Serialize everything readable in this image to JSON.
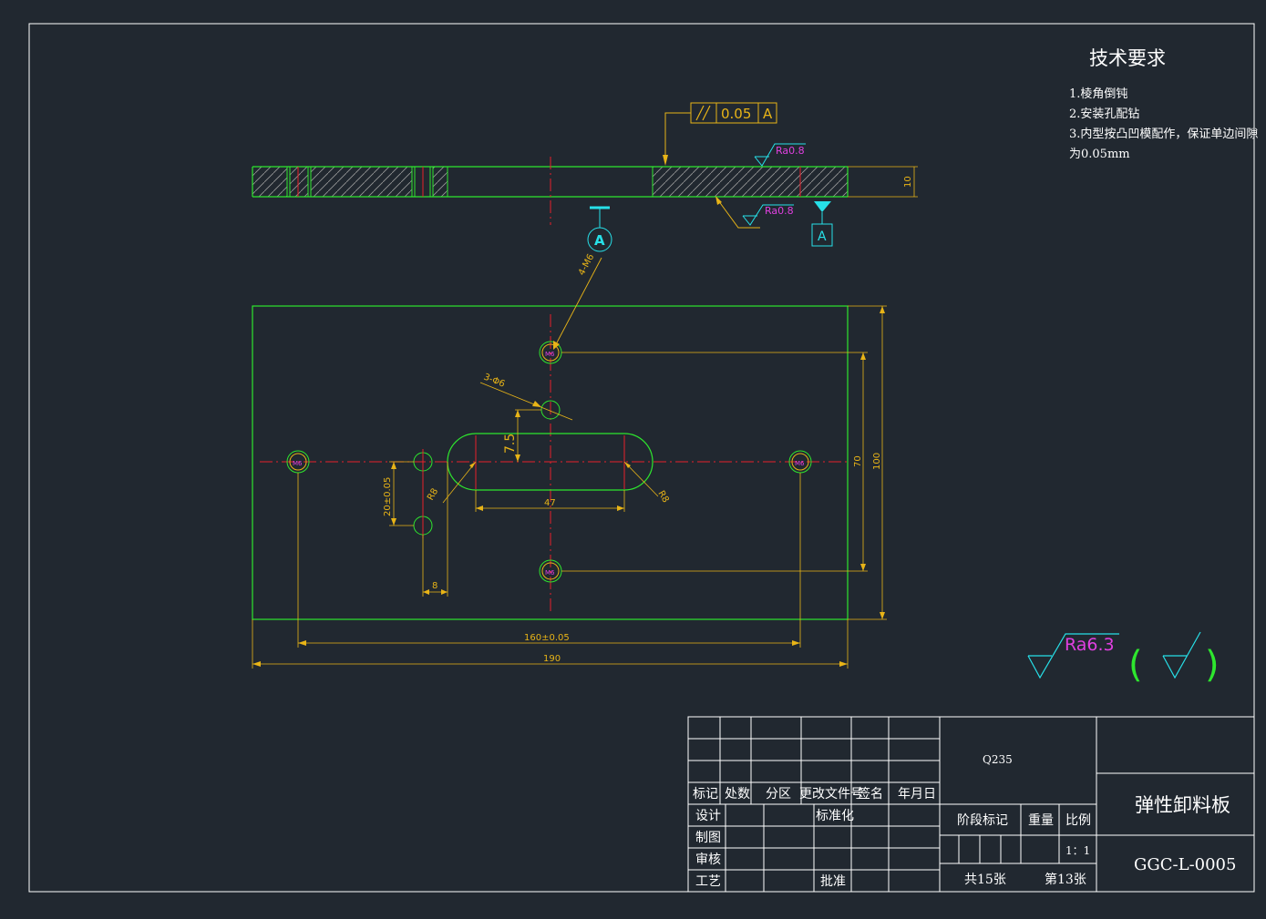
{
  "technical_requirements": {
    "title": "技术要求",
    "items": [
      "1.棱角倒钝",
      "2.安装孔配钻",
      "3.内型按凸凹模配作，保证单边间隙",
      "为0.05mm"
    ]
  },
  "dimensions": {
    "thickness": "10",
    "tolerance_value": "0.05",
    "datum": "A",
    "roughness_small": "Ra0.8",
    "roughness_general": "Ra6.3",
    "holes_m6": "4-M6",
    "holes_phi6": "3-Φ6",
    "thread_label": "M6",
    "slot_height": "7.5",
    "hole_spacing": "20±0.05",
    "slot_radius": "R8",
    "slot_length": "47",
    "edge_offset": "8",
    "inner_height": "70",
    "total_height": "100",
    "hole_span": "160±0.05",
    "total_width": "190"
  },
  "title_block": {
    "material": "Q235",
    "part_name": "弹性卸料板",
    "drawing_number": "GGC-L-0005",
    "labels": {
      "mark": "标记",
      "count": "处数",
      "zone": "分区",
      "change_doc": "更改文件号",
      "signature": "签名",
      "date": "年月日",
      "design": "设计",
      "standardize": "标准化",
      "drafting": "制图",
      "review": "审核",
      "process": "工艺",
      "approve": "批准",
      "stage_mark": "阶段标记",
      "weight": "重量",
      "scale": "比例",
      "scale_value": "1：1",
      "total_sheets": "共15张",
      "sheet_no": "第13张"
    }
  },
  "colors": {
    "background": "#212830",
    "outline": "#2ee62e",
    "dimension": "#e8b417",
    "centerline": "#e8202a",
    "text": "#ffffff",
    "roughness": "#e040e0",
    "datum": "#27e0e8",
    "hatch": "#9a9a9a",
    "frame": "#ffffff"
  }
}
